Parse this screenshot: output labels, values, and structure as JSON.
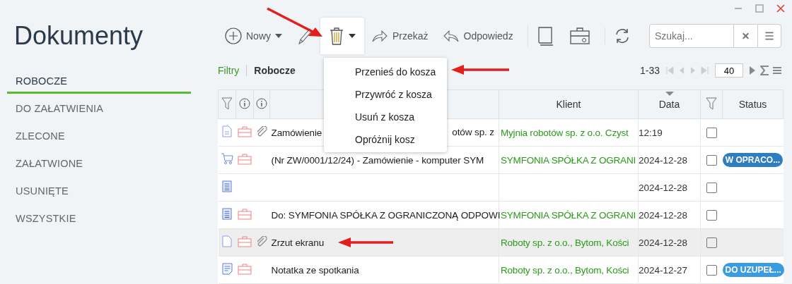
{
  "sidebar": {
    "title": "Dokumenty",
    "items": [
      {
        "label": "ROBOCZE",
        "selected": true
      },
      {
        "label": "DO ZAŁATWIENIA",
        "selected": false
      },
      {
        "label": "ZLECONE",
        "selected": false
      },
      {
        "label": "ZAŁATWIONE",
        "selected": false
      },
      {
        "label": "USUNIĘTE",
        "selected": false
      },
      {
        "label": "WSZYSTKIE",
        "selected": false
      }
    ]
  },
  "toolbar": {
    "new_label": "Nowy",
    "forward_label": "Przekaż",
    "reply_label": "Odpowiedz",
    "delete_pressed": true,
    "search": {
      "placeholder": "Szukaj..."
    }
  },
  "delete_menu": {
    "open": true,
    "items": [
      "Przenieś do kosza",
      "Przywróć z kosza",
      "Usuń z kosza",
      "Opróżnij kosz"
    ]
  },
  "filter_bar": {
    "filters": "Filtry",
    "view": "Robocze",
    "range": "1-33",
    "page_size": "40"
  },
  "table": {
    "columns": {
      "client": "Klient",
      "date": "Data",
      "status": "Status"
    },
    "rows": [
      {
        "kind": "text",
        "case": true,
        "attachment": true,
        "title": "Zamówienie",
        "title_end": "otów sp. z",
        "client": "Myjnia robotów sp. z o.o. Czyst",
        "date": "12:19",
        "checked": false,
        "selected": false
      },
      {
        "kind": "cart",
        "case": true,
        "attachment": false,
        "title": "(Nr ZW/0001/12/24) - Zamówienie - komputer SYM",
        "client": "SYMFONIA SPÓŁKA Z OGRANI",
        "date": "2024-12-28",
        "checked": false,
        "selected": false,
        "status": {
          "label": "W OPRACO...",
          "color": "#2e7ec1"
        }
      },
      {
        "kind": "sheet",
        "case": false,
        "attachment": false,
        "date": "2024-12-28",
        "checked": false,
        "selected": false
      },
      {
        "kind": "sheet",
        "case": true,
        "attachment": false,
        "title": "Do: SYMFONIA SPÓŁKA Z OGRANICZONĄ ODPOWI",
        "client": "SYMFONIA SPÓŁKA Z OGRANI",
        "date": "2024-12-28",
        "checked": false,
        "selected": false
      },
      {
        "kind": "blank",
        "case": true,
        "attachment": true,
        "title": "Zrzut ekranu",
        "client": "Roboty sp. z o.o., Bytom, Kości",
        "date": "2024-12-28",
        "checked": false,
        "selected": true
      },
      {
        "kind": "note",
        "case": true,
        "attachment": false,
        "title": "Notatka ze spotkania",
        "client": "Roboty sp. z o.o., Bytom, Kości",
        "date": "2024-12-27",
        "checked": false,
        "selected": false,
        "status": {
          "label": "DO UZUPEŁ...",
          "color": "#3b9be0"
        }
      }
    ]
  }
}
